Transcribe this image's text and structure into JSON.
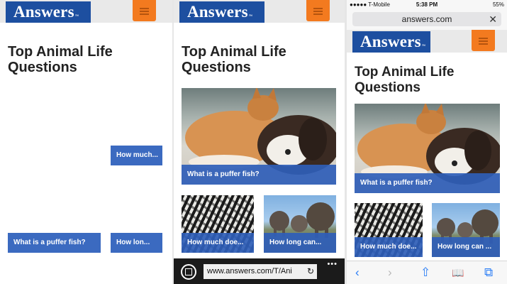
{
  "brand": {
    "logo": "Answers",
    "tm": "™",
    "accent": "#1d4fa0",
    "menu_color": "#f37a1f"
  },
  "page_title": "Top Animal Life Questions",
  "panel1": {
    "cards": [
      {
        "label": "How much..."
      },
      {
        "label": "What is a puffer fish?"
      },
      {
        "label": "How lon..."
      }
    ]
  },
  "panel2": {
    "cards": [
      {
        "label": "What is a puffer fish?"
      },
      {
        "label": "How much doe..."
      },
      {
        "label": "How long can..."
      }
    ],
    "browser": {
      "url": "www.answers.com/T/Ani",
      "more": "•••"
    }
  },
  "panel3": {
    "status": {
      "carrier": "●●●●● T-Mobile",
      "time": "5:38 PM",
      "battery": "55%"
    },
    "url": "answers.com",
    "cards": [
      {
        "label": "What is a puffer fish?"
      },
      {
        "label": "How much doe..."
      },
      {
        "label": "How long can ..."
      }
    ],
    "toolbar": {
      "back": "‹",
      "forward": "›",
      "share": "⇧",
      "bookmarks": "📖",
      "tabs": "⧉"
    }
  }
}
